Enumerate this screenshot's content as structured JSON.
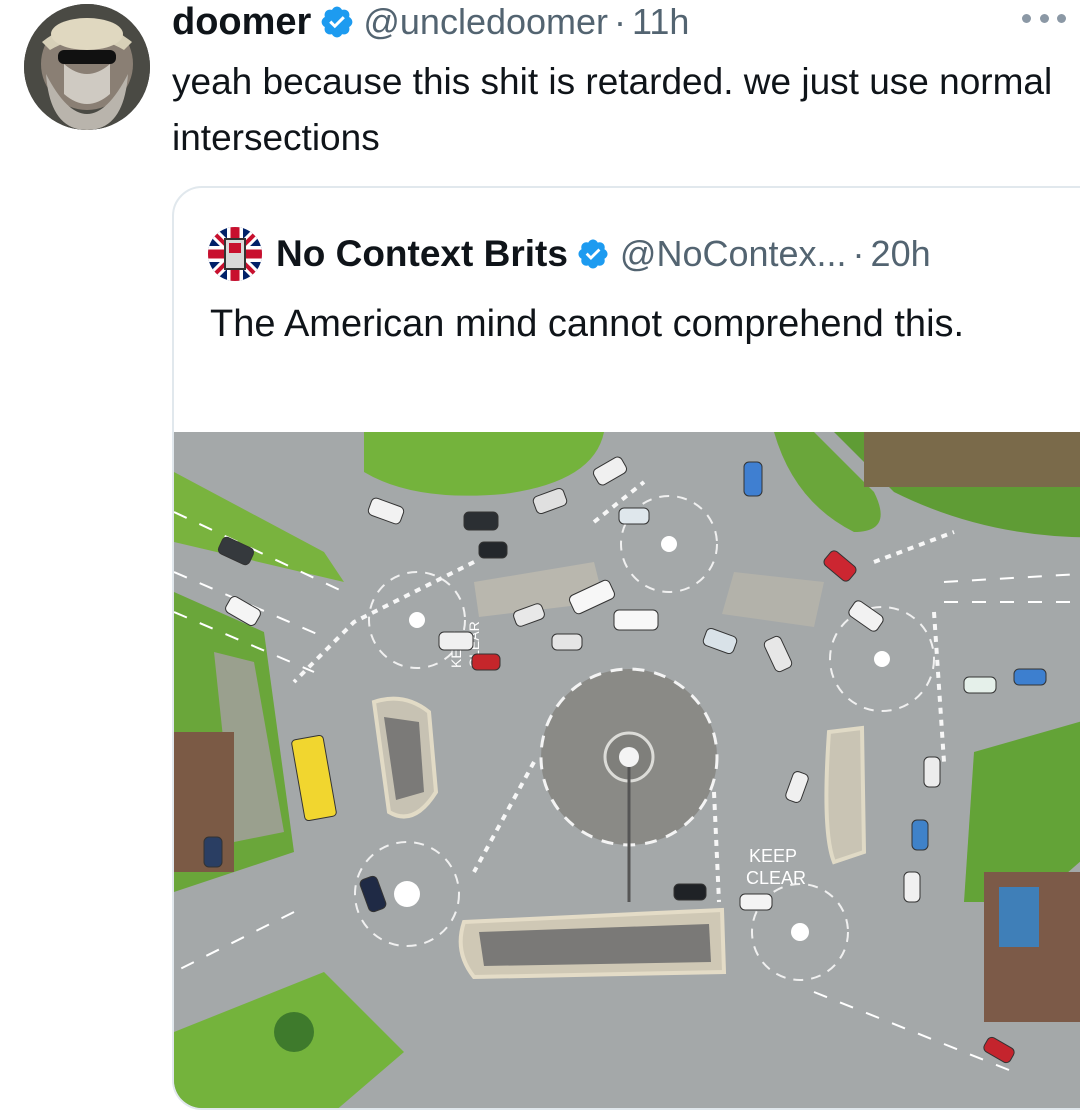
{
  "tweet": {
    "author": {
      "name": "doomer",
      "handle": "@uncledoomer",
      "verified": true,
      "avatar_icon": "user-avatar"
    },
    "separator": "·",
    "time": "11h",
    "more_icon": "more-horizontal-icon",
    "text": "yeah because this shit is retarded. we just use normal intersections"
  },
  "quoted_tweet": {
    "author": {
      "name": "No Context Brits",
      "handle": "@NoContex...",
      "verified": true,
      "avatar_icon": "union-flag-avatar"
    },
    "separator": "·",
    "time": "20h",
    "text": "The American mind cannot comprehend this.",
    "media": {
      "type": "photo",
      "subject": "magic-roundabout-aerial",
      "road_markings": [
        "KEEP",
        "CLEAR",
        "KEEP",
        "CLEAR"
      ]
    }
  },
  "colors": {
    "text_primary": "#0f1419",
    "text_secondary": "#536471",
    "verified_blue": "#1d9bf0",
    "border": "#e1e8ed",
    "asphalt": "#9ea2a3",
    "grass": "#6fb23a"
  }
}
